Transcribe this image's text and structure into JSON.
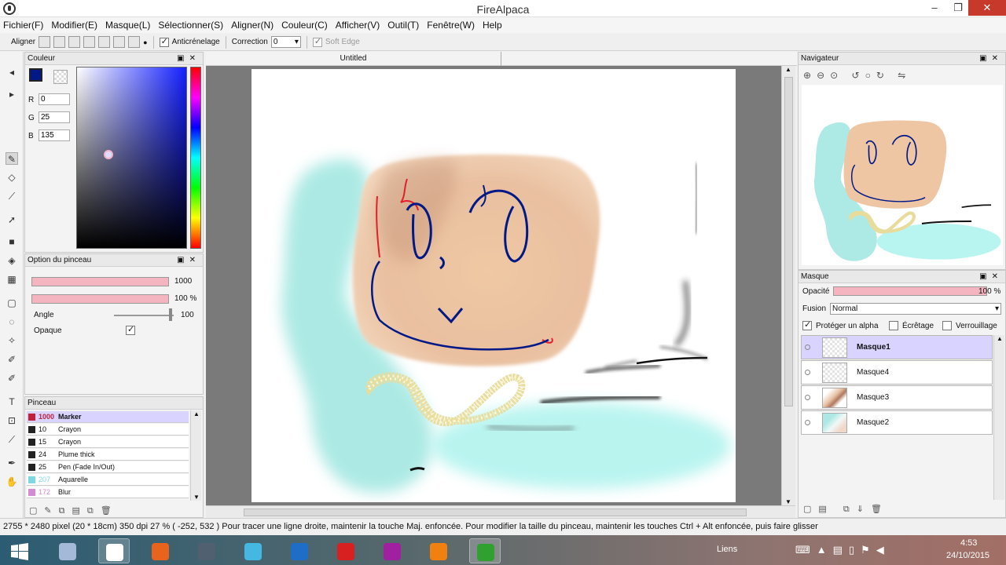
{
  "window": {
    "title": "FireAlpaca"
  },
  "menu": [
    "Fichier(F)",
    "Modifier(E)",
    "Masque(L)",
    "Sélectionner(S)",
    "Aligner(N)",
    "Couleur(C)",
    "Afficher(V)",
    "Outil(T)",
    "Fenêtre(W)",
    "Help"
  ],
  "toolopts": {
    "align_label": "Aligner",
    "antialias_label": "Anticrénelage",
    "correction_label": "Correction",
    "correction_value": "0",
    "softedge_label": "Soft Edge"
  },
  "color_panel": {
    "title": "Couleur",
    "r_label": "R",
    "r_value": "0",
    "g_label": "G",
    "g_value": "25",
    "b_label": "B",
    "b_value": "135",
    "fg_color": "#001987"
  },
  "brush_options": {
    "title": "Option du pinceau",
    "size_value": "1000",
    "opacity_value": "100 %",
    "angle_label": "Angle",
    "angle_value": "100",
    "opaque_label": "Opaque"
  },
  "brush_panel": {
    "title": "Pinceau",
    "items": [
      {
        "size": "1000",
        "name": "Marker",
        "color": "#c0203a",
        "selected": true
      },
      {
        "size": "10",
        "name": "Crayon",
        "color": "#222222"
      },
      {
        "size": "15",
        "name": "Crayon",
        "color": "#222222"
      },
      {
        "size": "24",
        "name": "Plume thick",
        "color": "#222222"
      },
      {
        "size": "25",
        "name": "Pen (Fade In/Out)",
        "color": "#222222"
      },
      {
        "size": "207",
        "name": "Aquarelle",
        "color": "#7fd8e0"
      },
      {
        "size": "172",
        "name": "Blur",
        "color": "#d48ad4"
      }
    ]
  },
  "canvas": {
    "tab_title": "Untitled"
  },
  "navigator": {
    "title": "Navigateur"
  },
  "layer_panel": {
    "title": "Masque",
    "opacity_label": "Opacité",
    "opacity_value": "100 %",
    "blend_label": "Fusion",
    "blend_value": "Normal",
    "protect_alpha_label": "Protéger un alpha",
    "clipping_label": "Écrêtage",
    "lock_label": "Verrouillage",
    "layers": [
      {
        "name": "Masque1",
        "selected": true
      },
      {
        "name": "Masque4",
        "selected": false
      },
      {
        "name": "Masque3",
        "selected": false
      },
      {
        "name": "Masque2",
        "selected": false
      }
    ]
  },
  "status": {
    "size": "2755 * 2480 pixel",
    "cm": "(20 * 18cm)",
    "dpi": "350 dpi",
    "zoom": "27 %",
    "coords": "( -252, 532 )",
    "hint": "Pour tracer une ligne droite, maintenir la touche Maj. enfoncée. Pour modifier la taille du pinceau, maintenir les touches Ctrl + Alt enfoncée, puis faire glisser"
  },
  "taskbar": {
    "links_label": "Liens",
    "time": "4:53",
    "date": "24/10/2015",
    "apps": [
      {
        "name": "pyramid-app",
        "color": "#a4b8d8"
      },
      {
        "name": "alpaca-app",
        "color": "#ffffff"
      },
      {
        "name": "firefox-app",
        "color": "#e8641c"
      },
      {
        "name": "scanner-app",
        "color": "#506070"
      },
      {
        "name": "skype-app",
        "color": "#44b8e0"
      },
      {
        "name": "ie-app",
        "color": "#1e6ec8"
      },
      {
        "name": "media-app",
        "color": "#d82020"
      },
      {
        "name": "camera-app",
        "color": "#a020a0"
      },
      {
        "name": "vlc-app",
        "color": "#f08010"
      },
      {
        "name": "camtasia-app",
        "color": "#30a030"
      }
    ]
  }
}
